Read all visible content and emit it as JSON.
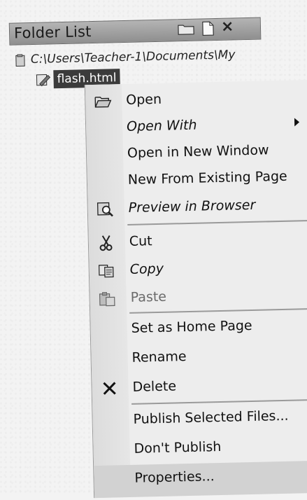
{
  "panel": {
    "title": "Folder List",
    "path": "C:\\Users\\Teacher-1\\Documents\\My",
    "selected_file": "flash.html",
    "header_icons": [
      "new-folder-icon",
      "new-page-icon",
      "close-icon"
    ]
  },
  "context_menu": {
    "items": [
      {
        "label": "Open",
        "icon": "open-folder-icon"
      },
      {
        "label": "Open With",
        "icon": "",
        "submenu": true
      },
      {
        "label": "Open in New Window",
        "icon": ""
      },
      {
        "label": "New From Existing Page",
        "icon": ""
      },
      {
        "label": "Preview in Browser",
        "icon": "preview-icon"
      },
      {
        "label": "Cut",
        "icon": "scissors-icon"
      },
      {
        "label": "Copy",
        "icon": "copy-icon"
      },
      {
        "label": "Paste",
        "icon": "paste-icon",
        "disabled": true
      },
      {
        "label": "Set as Home Page",
        "icon": ""
      },
      {
        "label": "Rename",
        "icon": ""
      },
      {
        "label": "Delete",
        "icon": "delete-x-icon"
      },
      {
        "label": "Publish Selected Files...",
        "icon": ""
      },
      {
        "label": "Don't Publish",
        "icon": ""
      },
      {
        "label": "Properties...",
        "icon": ""
      }
    ]
  },
  "colors": {
    "header_bg": "#9e9e9e",
    "selection_bg": "#3b3b3b",
    "menu_bg": "#ededed"
  }
}
